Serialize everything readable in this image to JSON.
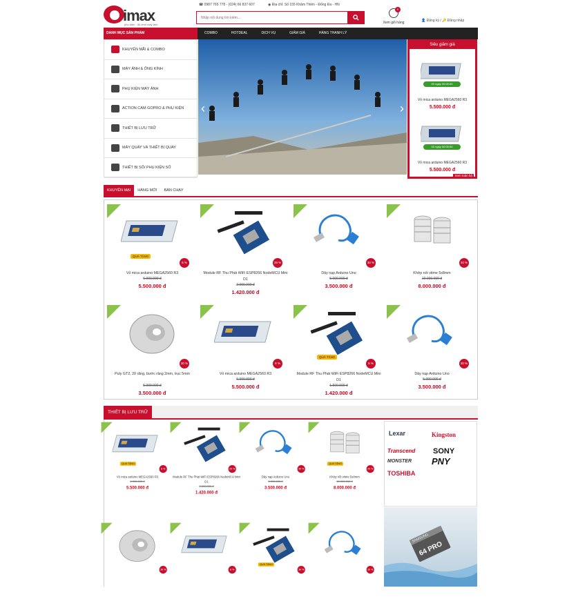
{
  "header": {
    "logo_text": "imax",
    "logo_tagline": "phụ kiện - đồ chơi máy ảnh",
    "phone": "0987 765 778 - (024) 66 837 607",
    "address": "Địa chỉ: Số 155 Khâm Thiên - Đống Đa - HN",
    "search_placeholder": "Nhập nội dung tìm kiếm....",
    "cart_count": "0",
    "cart_label": "Xem giỏ hàng",
    "register": "Đăng ký",
    "separator": "/",
    "login": "Đăng nhập"
  },
  "nav": {
    "category_title": "DANH MỤC SẢN PHẨM",
    "items": [
      "COMBO",
      "HOTDEAL",
      "DỊCH VỤ",
      "GIẢM GIÁ",
      "HÀNG THANH LÝ"
    ]
  },
  "sidebar": {
    "items": [
      {
        "label": "KHUYẾN MÃI & COMBO",
        "icon": "gift-icon"
      },
      {
        "label": "MÁY ẢNH & ỐNG KÍNH",
        "icon": "camera-icon"
      },
      {
        "label": "PHỤ KIỆN MÁY ẢNH",
        "icon": "camera-accessory-icon"
      },
      {
        "label": "ACTION CAM GOPRO & PHỤ KIỆN",
        "icon": "action-cam-icon"
      },
      {
        "label": "THIẾT BỊ LƯU TRỮ",
        "icon": "sd-card-icon"
      },
      {
        "label": "MÁY QUAY VÀ THIẾT BỊ QUAY",
        "icon": "video-camera-icon"
      },
      {
        "label": "THIẾT BỊ SỐ/ PHỤ KIỆN SỐ",
        "icon": "phone-icon"
      }
    ]
  },
  "banner": {
    "prev": "‹",
    "next": "›"
  },
  "deal": {
    "title": "Siêu giảm giá",
    "items": [
      {
        "timer": "00 ngày 00:00:00",
        "name": "Vỏ mica arduino MEGA2560 R3",
        "price": "5.500.000 đ"
      },
      {
        "timer": "00 ngày 00:00:00",
        "name": "Vỏ mica arduino MEGA2560 R3",
        "price": "5.500.000 đ"
      }
    ],
    "more": "Xem toàn bộ"
  },
  "tabs": [
    "KHUYẾN MẠI",
    "HÀNG MỚI",
    "BÁN CHẠY"
  ],
  "gift_label": "QUÀ TẶNG",
  "promo_products": [
    {
      "name": "Vỏ mica arduino MEGA2560 R3",
      "old": "6.000.000 đ",
      "price": "5.500.000 đ",
      "discount": "8 %",
      "img": "case",
      "gift": true
    },
    {
      "name": "Module RF Thu Phát WiFi ESP8266 NodeMCU Mini D1",
      "old": "2.000.000 đ",
      "price": "1.420.000 đ",
      "discount": "29 %",
      "img": "module",
      "gift": false
    },
    {
      "name": "Dây nạp Arduino Uno",
      "old": "5.000.000 đ",
      "price": "3.500.000 đ",
      "discount": "30 %",
      "img": "cable",
      "gift": false
    },
    {
      "name": "Khớp nối vitme 5x8mm",
      "old": "10.000.000 đ",
      "price": "8.000.000 đ",
      "discount": "20 %",
      "img": "coupler",
      "gift": false
    },
    {
      "name": "Puly GT2, 20 răng, bước răng 2mm, trục 5mm",
      "old": "5.000.000 đ",
      "price": "3.500.000 đ",
      "discount": "30 %",
      "img": "pulley",
      "gift": false
    },
    {
      "name": "Vỏ mica arduino MEGA2560 R3",
      "old": "6.000.000 đ",
      "price": "5.500.000 đ",
      "discount": "8 %",
      "img": "case",
      "gift": false
    },
    {
      "name": "Module RF Thu Phát WiFi ESP8266 NodeMCU Mini D1",
      "old": "1.500.000 đ",
      "price": "1.420.000 đ",
      "discount": "5 %",
      "img": "module",
      "gift": true
    },
    {
      "name": "Dây nạp Arduino Uno",
      "old": "5.000.000 đ",
      "price": "3.500.000 đ",
      "discount": "30 %",
      "img": "cable",
      "gift": false
    }
  ],
  "section2": {
    "title": "THIẾT BỊ LƯU TRỮ"
  },
  "storage_products": [
    {
      "name": "Vỏ mica arduino MEGA2560 R3",
      "old": "6.000.000 đ",
      "price": "5.500.000 đ",
      "discount": "8 %",
      "img": "case",
      "gift": true
    },
    {
      "name": "Module RF Thu Phát WiFi ESP8266 NodeMCU Mini D1",
      "old": "2.000.000 đ",
      "price": "1.420.000 đ",
      "discount": "29 %",
      "img": "module",
      "gift": false
    },
    {
      "name": "Dây nạp Arduino Uno",
      "old": "5.000.000 đ",
      "price": "3.500.000 đ",
      "discount": "30 %",
      "img": "cable",
      "gift": false
    },
    {
      "name": "Khớp nối vitme 5x8mm",
      "old": "10.000.000 đ",
      "price": "8.000.000 đ",
      "discount": "20 %",
      "img": "coupler",
      "gift": true
    },
    {
      "name": "",
      "old": "",
      "price": "",
      "discount": "30 %",
      "img": "pulley",
      "gift": false
    },
    {
      "name": "",
      "old": "",
      "price": "",
      "discount": "8 %",
      "img": "case",
      "gift": false
    },
    {
      "name": "",
      "old": "",
      "price": "",
      "discount": "30 %",
      "img": "module",
      "gift": true
    },
    {
      "name": "",
      "old": "",
      "price": "",
      "discount": "30 %",
      "img": "cable",
      "gift": false
    }
  ],
  "brands": [
    "Lexar",
    "Kingston",
    "Transcend",
    "SONY",
    "MONSTER",
    "PNY",
    "TOSHIBA"
  ],
  "ad": {
    "brand": "SAMSUNG",
    "badge": "64 PRO"
  },
  "colors": {
    "primary": "#c8102e",
    "nav": "#222222",
    "timer": "#3a9b2c",
    "new_badge": "#8bc34a"
  }
}
